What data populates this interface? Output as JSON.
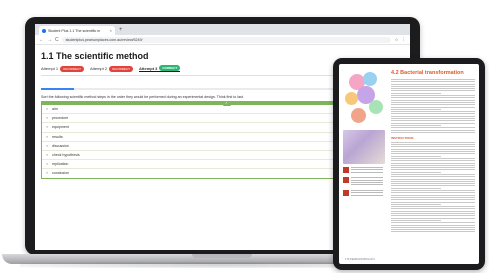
{
  "browser": {
    "tab_title": "Student Plus 1.1 The scientific m",
    "tab_close": "×",
    "new_tab": "+",
    "url": "studentplus.pearsonplaces.com.au/review/5249/",
    "nav_back": "←",
    "nav_forward": "→",
    "nav_reload": "C",
    "right_icons": [
      "☆",
      "⋮"
    ]
  },
  "page": {
    "title": "1.1 The scientific method",
    "attempts": [
      {
        "label": "Attempt 1",
        "badge": "INCORRECT",
        "badge_color": "#e0443a",
        "active": false
      },
      {
        "label": "Attempt 2",
        "badge": "INCORRECT",
        "badge_color": "#e0443a",
        "active": false
      },
      {
        "label": "Attempt 3",
        "badge": "CORRECT",
        "badge_color": "#2bb673",
        "active": true
      }
    ],
    "progress_fraction": 0.09,
    "instruction": "Sort the following scientific method steps in the order they would be performed during an experimental design. Think first to last.",
    "check_mark": "✓",
    "handle": "≡",
    "items": [
      "aim",
      "procedure",
      "equipment",
      "results",
      "discussion",
      "check hypothesis",
      "replication",
      "conclusion"
    ]
  },
  "tablet": {
    "heading": "4.2 Bacterial transformation",
    "subheading": "INSTRUCTIONS",
    "footer": "176  PEARSON BIOLOGY"
  },
  "colors": {
    "accent": "#7fb55a",
    "progress": "#3b82f6",
    "heading": "#e05a2b"
  }
}
